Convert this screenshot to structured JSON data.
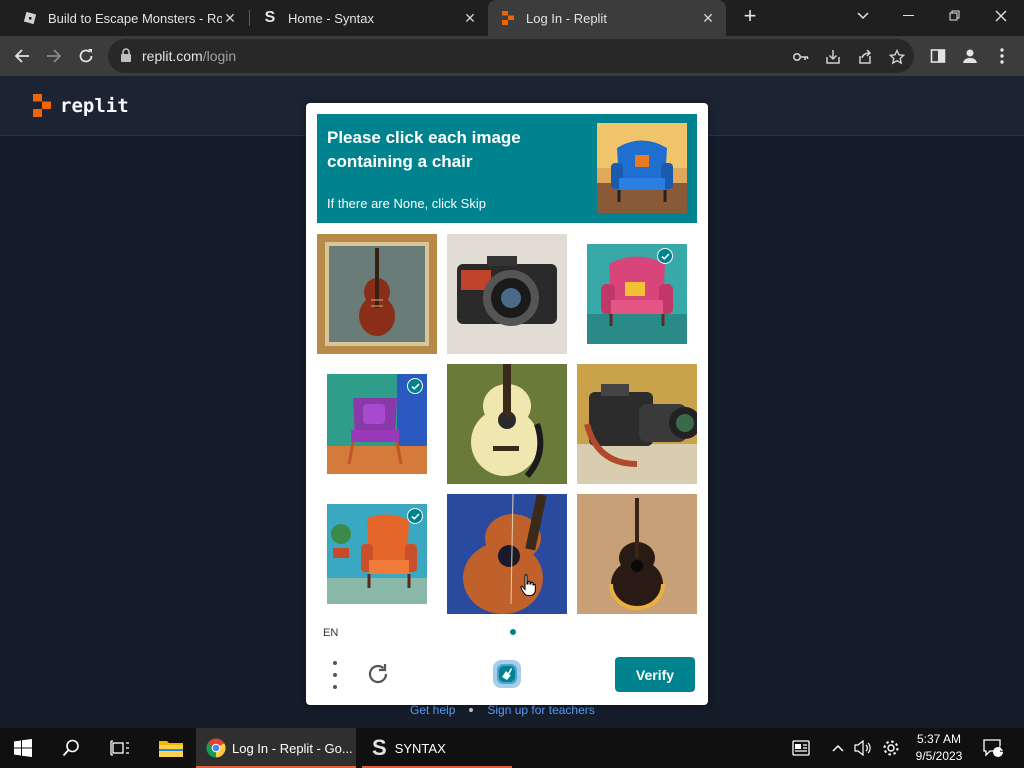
{
  "browser": {
    "tabs": [
      {
        "title": "Build to Escape Monsters - Roblo",
        "icon": "roblox-icon",
        "active": false
      },
      {
        "title": "Home - Syntax",
        "icon": "syntax-s-icon",
        "active": false
      },
      {
        "title": "Log In - Replit",
        "icon": "replit-icon",
        "active": true
      }
    ],
    "url_host": "replit.com",
    "url_path": "/login"
  },
  "site": {
    "brand": "replit",
    "footer_links": [
      "Get help",
      "Sign up for teachers"
    ]
  },
  "captcha": {
    "prompt_title": "Please click each image containing a chair",
    "prompt_sub": "If there are None, click Skip",
    "example_image": "blue armchair",
    "tiles": [
      {
        "subject": "violin",
        "selected": false
      },
      {
        "subject": "camera",
        "selected": false
      },
      {
        "subject": "pink armchair",
        "selected": true
      },
      {
        "subject": "purple chair",
        "selected": true
      },
      {
        "subject": "acoustic guitar",
        "selected": false
      },
      {
        "subject": "camera",
        "selected": false
      },
      {
        "subject": "orange armchair",
        "selected": true
      },
      {
        "subject": "guitar",
        "selected": false
      },
      {
        "subject": "guitar",
        "selected": false
      }
    ],
    "language": "EN",
    "verify_label": "Verify",
    "accent": "#00838f"
  },
  "taskbar": {
    "apps": [
      {
        "label": "Log In - Replit - Go...",
        "icon": "chrome-icon",
        "active": true
      },
      {
        "label": "SYNTAX",
        "icon": "syntax-s-icon",
        "active": false
      }
    ],
    "time": "5:37 AM",
    "date": "9/5/2023",
    "notifications": "3"
  }
}
